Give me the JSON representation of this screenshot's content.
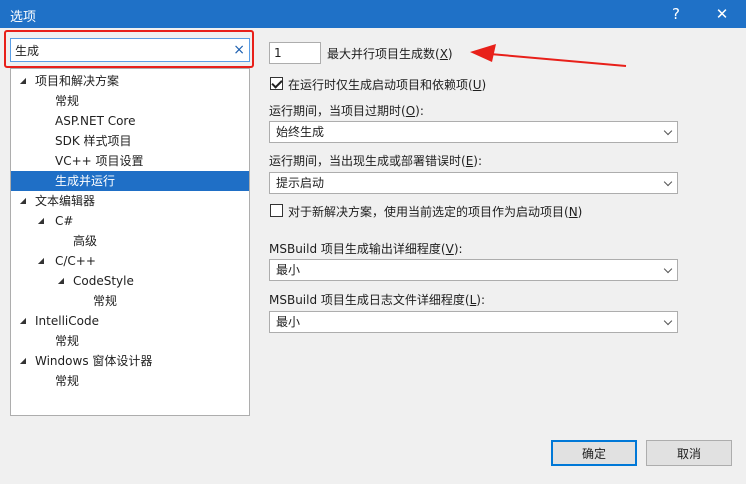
{
  "window": {
    "title": "选项",
    "help": "?",
    "close": "✕"
  },
  "search": {
    "value": "生成",
    "clear": "×"
  },
  "tree": [
    {
      "label": "项目和解决方案",
      "arrow": "◢"
    },
    {
      "label": "常规"
    },
    {
      "label": "ASP.NET Core"
    },
    {
      "label": "SDK 样式项目"
    },
    {
      "label": "VC++ 项目设置"
    },
    {
      "label": "生成并运行"
    },
    {
      "label": "文本编辑器",
      "arrow": "◢"
    },
    {
      "label": "C#",
      "arrow": "◢"
    },
    {
      "label": "高级"
    },
    {
      "label": "C/C++",
      "arrow": "◢"
    },
    {
      "label": "CodeStyle",
      "arrow": "◢"
    },
    {
      "label": "常规"
    },
    {
      "label": "IntelliCode",
      "arrow": "◢"
    },
    {
      "label": "常规"
    },
    {
      "label": "Windows 窗体设计器",
      "arrow": "◢"
    },
    {
      "label": "常规"
    }
  ],
  "settings": {
    "parallel_count": "1",
    "parallel_label": "最大并行项目生成数(",
    "parallel_key": "X",
    "parallel_end": ")",
    "only_startup_label": "在运行时仅生成启动项目和依赖项(",
    "only_startup_key": "U",
    "only_startup_end": ")",
    "outdated_label": "运行期间，当项目过期时(",
    "outdated_key": "O",
    "outdated_end": "):",
    "outdated_value": "始终生成",
    "errors_label": "运行期间，当出现生成或部署错误时(",
    "errors_key": "E",
    "errors_end": "):",
    "errors_value": "提示启动",
    "new_solution_label": "对于新解决方案，使用当前选定的项目作为启动项目(",
    "new_solution_key": "N",
    "new_solution_end": ")",
    "output_verbosity_label": "MSBuild 项目生成输出详细程度(",
    "output_verbosity_key": "V",
    "output_verbosity_end": "):",
    "output_verbosity_value": "最小",
    "log_verbosity_label": "MSBuild 项目生成日志文件详细程度(",
    "log_verbosity_key": "L",
    "log_verbosity_end": "):",
    "log_verbosity_value": "最小"
  },
  "buttons": {
    "ok": "确定",
    "cancel": "取消"
  },
  "colors": {
    "titlebar": "#1f71c7",
    "selection": "#1f6fc6",
    "annotation": "#e8201a"
  }
}
